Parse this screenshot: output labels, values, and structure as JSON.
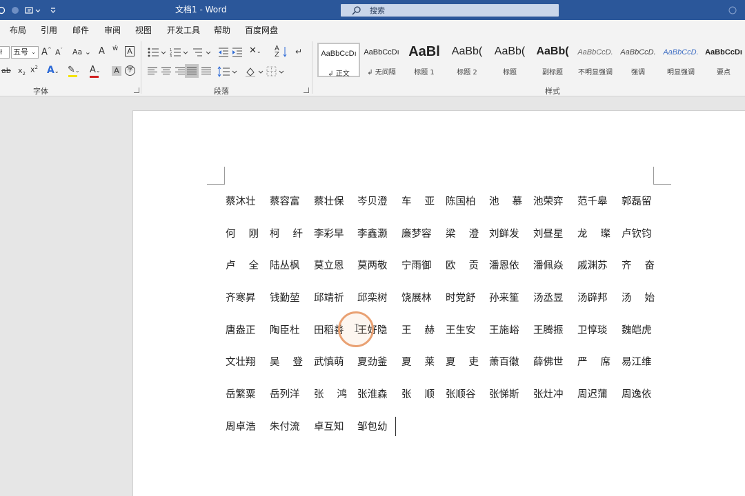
{
  "titlebar": {
    "doc_title": "文档1 - Word",
    "search_placeholder": "搜索",
    "accent": "#2b579a"
  },
  "tabs": [
    "布局",
    "引用",
    "邮件",
    "审阅",
    "视图",
    "开发工具",
    "帮助",
    "百度网盘"
  ],
  "ribbon": {
    "font_size": "五号",
    "groups": {
      "font": "字体",
      "paragraph": "段落",
      "styles": "样式"
    },
    "styles": [
      {
        "sample": "AaBbCcDı",
        "name": "↲ 正文"
      },
      {
        "sample": "AaBbCcDı",
        "name": "↲ 无间隔"
      },
      {
        "sample": "AaBl",
        "name": "标题 1"
      },
      {
        "sample": "AaBb(",
        "name": "标题 2"
      },
      {
        "sample": "AaBb(",
        "name": "标题"
      },
      {
        "sample": "AaBb(",
        "name": "副标题"
      },
      {
        "sample": "AaBbCcD.",
        "name": "不明显强调"
      },
      {
        "sample": "AaBbCcD.",
        "name": "强调"
      },
      {
        "sample": "AaBbCcD.",
        "name": "明显强调"
      },
      {
        "sample": "AaBbCcDı",
        "name": "要点"
      }
    ]
  },
  "document": {
    "rows": [
      [
        "蔡沐壮",
        "蔡容富",
        "蔡壮保",
        "岑贝澄",
        "车亚",
        "陈国柏",
        "池慕",
        "池荣弈",
        "范千皋",
        "郭磊留"
      ],
      [
        "何刚",
        "柯纤",
        "李彩早",
        "李鑫灏",
        "廉梦容",
        "梁澄",
        "刘鲜发",
        "刘昼星",
        "龙璨",
        "卢钦钧"
      ],
      [
        "卢全",
        "陆丛枫",
        "莫立恩",
        "莫两敬",
        "宁雨御",
        "欧贡",
        "潘恩依",
        "潘佩焱",
        "戚渊苏",
        "齐奋"
      ],
      [
        "齐寒昇",
        "钱勤堃",
        "邱靖祈",
        "邱栾树",
        "饶展林",
        "时党舒",
        "孙来笙",
        "汤丞昱",
        "汤辟邦",
        "汤始"
      ],
      [
        "唐盎正",
        "陶臣杜",
        "田稻善",
        "王好隐",
        "王赫",
        "王生安",
        "王施峪",
        "王腾振",
        "卫惇琰",
        "魏皑虎"
      ],
      [
        "文壮翔",
        "吴登",
        "武慎萌",
        "夏劲釜",
        "夏莱",
        "夏吏",
        "萧百徽",
        "薛佛世",
        "严席",
        "易江维"
      ],
      [
        "岳繁粟",
        "岳列洋",
        "张鸿",
        "张淮森",
        "张顺",
        "张顺谷",
        "张悌斯",
        "张灶冲",
        "周迟蒲",
        "周逸依"
      ],
      [
        "周卓浩",
        "朱付流",
        "卓互知",
        "邹包幼"
      ]
    ]
  }
}
